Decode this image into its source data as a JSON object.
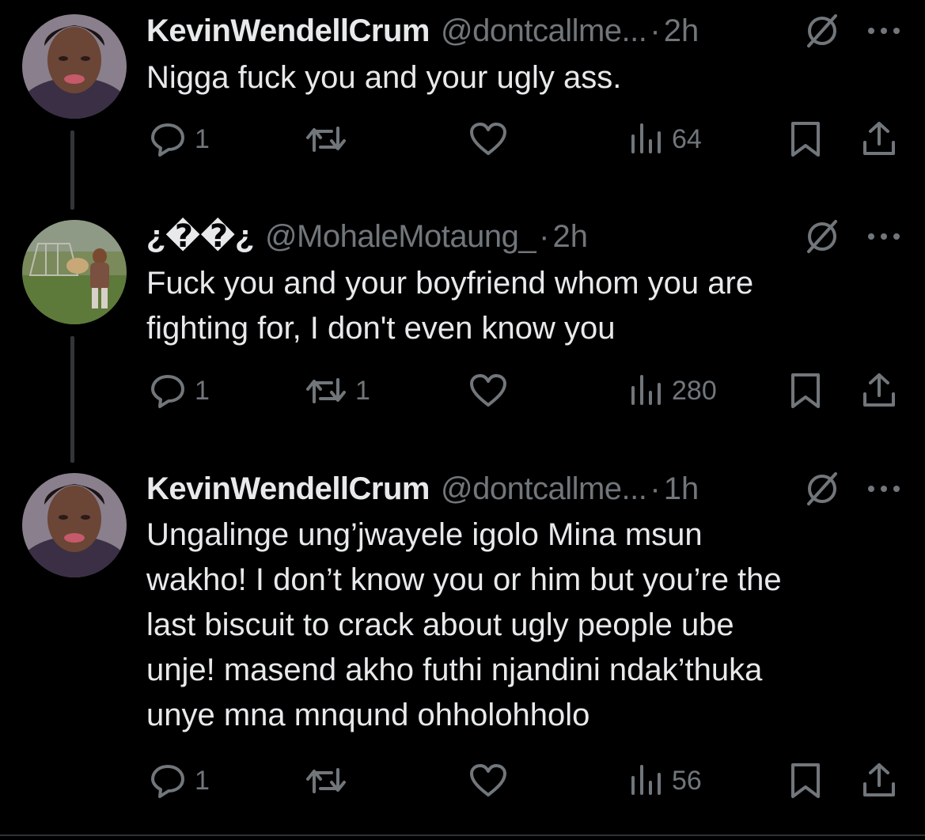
{
  "tweets": [
    {
      "name": "KevinWendellCrum",
      "handle": "@dontcallme...",
      "dot": "·",
      "time": "2h",
      "text": [
        "Nigga fuck you and your ugly ass."
      ],
      "replies": "1",
      "retweets": "",
      "views": "64"
    },
    {
      "name": "¿��¿",
      "handle": "@MohaleMotaung_",
      "dot": "·",
      "time": "2h",
      "text": [
        "Fuck you and your boyfriend whom you are",
        "fighting for, I don't even know you"
      ],
      "replies": "1",
      "retweets": "1",
      "views": "280"
    },
    {
      "name": "KevinWendellCrum",
      "handle": "@dontcallme...",
      "dot": "·",
      "time": "1h",
      "text": [
        "Ungalinge ung’jwayele igolo Mina msun",
        "wakho! I don’t know you or him but you’re the",
        "last biscuit to crack about ugly people ube",
        "unje!  masend akho futhi njandini ndak’thuka",
        "unye mna mnqund ohholohholo"
      ],
      "replies": "1",
      "retweets": "",
      "views": "56"
    }
  ],
  "icons": {
    "reply": "reply-icon",
    "retweet": "retweet-icon",
    "like": "heart-icon",
    "views": "views-icon",
    "bookmark": "bookmark-icon",
    "share": "share-icon",
    "grok": "grok-icon",
    "more": "more-icon"
  },
  "colors": {
    "background": "#000000",
    "text": "#e7e9ea",
    "secondary": "#71767b"
  }
}
